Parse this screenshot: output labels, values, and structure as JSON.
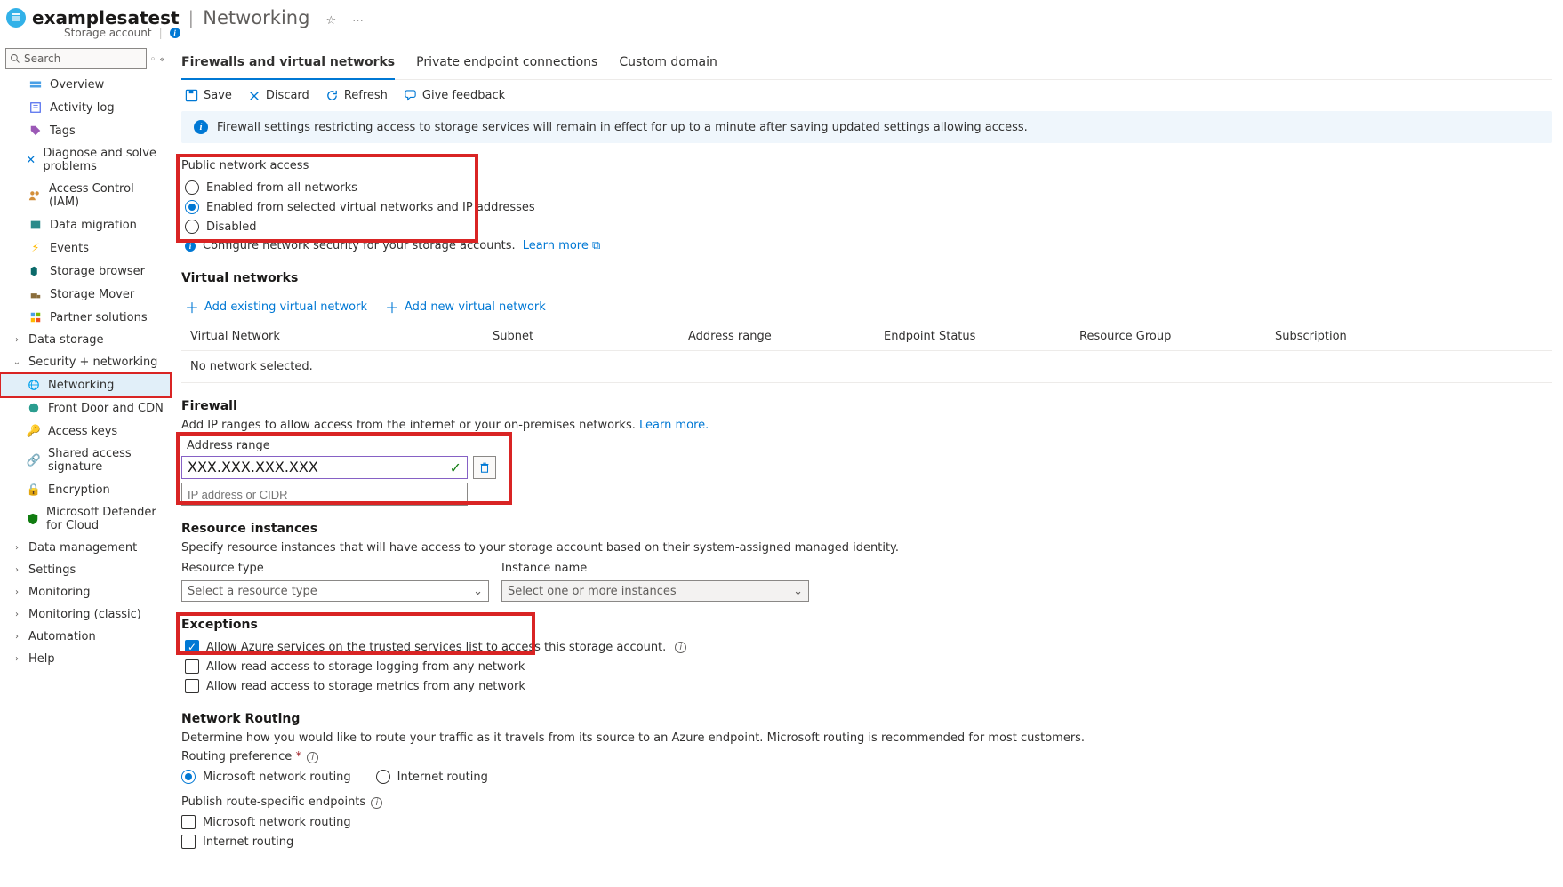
{
  "header": {
    "resource": "examplesatest",
    "page": "Networking",
    "subtitle": "Storage account"
  },
  "sidebar": {
    "search_ph": "Search",
    "items": [
      {
        "label": "Overview",
        "icon": "overview"
      },
      {
        "label": "Activity log",
        "icon": "log"
      },
      {
        "label": "Tags",
        "icon": "tag"
      },
      {
        "label": "Diagnose and solve problems",
        "icon": "diag"
      },
      {
        "label": "Access Control (IAM)",
        "icon": "iam"
      },
      {
        "label": "Data migration",
        "icon": "migrate"
      },
      {
        "label": "Events",
        "icon": "events"
      },
      {
        "label": "Storage browser",
        "icon": "browser"
      },
      {
        "label": "Storage Mover",
        "icon": "mover"
      },
      {
        "label": "Partner solutions",
        "icon": "partner"
      }
    ],
    "groups": [
      {
        "label": "Data storage",
        "expanded": false,
        "children": []
      },
      {
        "label": "Security + networking",
        "expanded": true,
        "children": [
          {
            "label": "Networking",
            "icon": "net",
            "selected": true,
            "highlight": true
          },
          {
            "label": "Front Door and CDN",
            "icon": "cdn"
          },
          {
            "label": "Access keys",
            "icon": "keys"
          },
          {
            "label": "Shared access signature",
            "icon": "sas"
          },
          {
            "label": "Encryption",
            "icon": "enc"
          },
          {
            "label": "Microsoft Defender for Cloud",
            "icon": "def"
          }
        ]
      },
      {
        "label": "Data management",
        "expanded": false,
        "children": []
      },
      {
        "label": "Settings",
        "expanded": false,
        "children": []
      },
      {
        "label": "Monitoring",
        "expanded": false,
        "children": []
      },
      {
        "label": "Monitoring (classic)",
        "expanded": false,
        "children": []
      },
      {
        "label": "Automation",
        "expanded": false,
        "children": []
      },
      {
        "label": "Help",
        "expanded": false,
        "children": []
      }
    ]
  },
  "tabs": [
    "Firewalls and virtual networks",
    "Private endpoint connections",
    "Custom domain"
  ],
  "active_tab": 0,
  "commands": {
    "save": "Save",
    "discard": "Discard",
    "refresh": "Refresh",
    "feedback": "Give feedback"
  },
  "info_banner": "Firewall settings restricting access to storage services will remain in effect for up to a minute after saving updated settings allowing access.",
  "pna": {
    "heading": "Public network access",
    "opt1": "Enabled from all networks",
    "opt2": "Enabled from selected virtual networks and IP addresses",
    "opt3": "Disabled",
    "selected": 1,
    "hint_prefix": "Configure network security for your storage accounts.",
    "hint_link": "Learn more"
  },
  "vnet": {
    "heading": "Virtual networks",
    "add_existing": "Add existing virtual network",
    "add_new": "Add new virtual network",
    "cols": [
      "Virtual Network",
      "Subnet",
      "Address range",
      "Endpoint Status",
      "Resource Group",
      "Subscription"
    ],
    "empty": "No network selected."
  },
  "firewall": {
    "heading": "Firewall",
    "desc": "Add IP ranges to allow access from the internet or your on-premises networks.",
    "learn": "Learn more.",
    "col": "Address range",
    "value": "XXX.XXX.XXX.XXX",
    "placeholder": "IP address or CIDR"
  },
  "ri": {
    "heading": "Resource instances",
    "desc": "Specify resource instances that will have access to your storage account based on their system-assigned managed identity.",
    "type_label": "Resource type",
    "name_label": "Instance name",
    "type_ph": "Select a resource type",
    "name_ph": "Select one or more instances"
  },
  "exc": {
    "heading": "Exceptions",
    "c1": "Allow Azure services on the trusted services list to access this storage account.",
    "c2": "Allow read access to storage logging from any network",
    "c3": "Allow read access to storage metrics from any network"
  },
  "nr": {
    "heading": "Network Routing",
    "desc": "Determine how you would like to route your traffic as it travels from its source to an Azure endpoint. Microsoft routing is recommended for most customers.",
    "pref_label": "Routing preference",
    "opt1": "Microsoft network routing",
    "opt2": "Internet routing",
    "pub_label": "Publish route-specific endpoints",
    "p1": "Microsoft network routing",
    "p2": "Internet routing"
  }
}
